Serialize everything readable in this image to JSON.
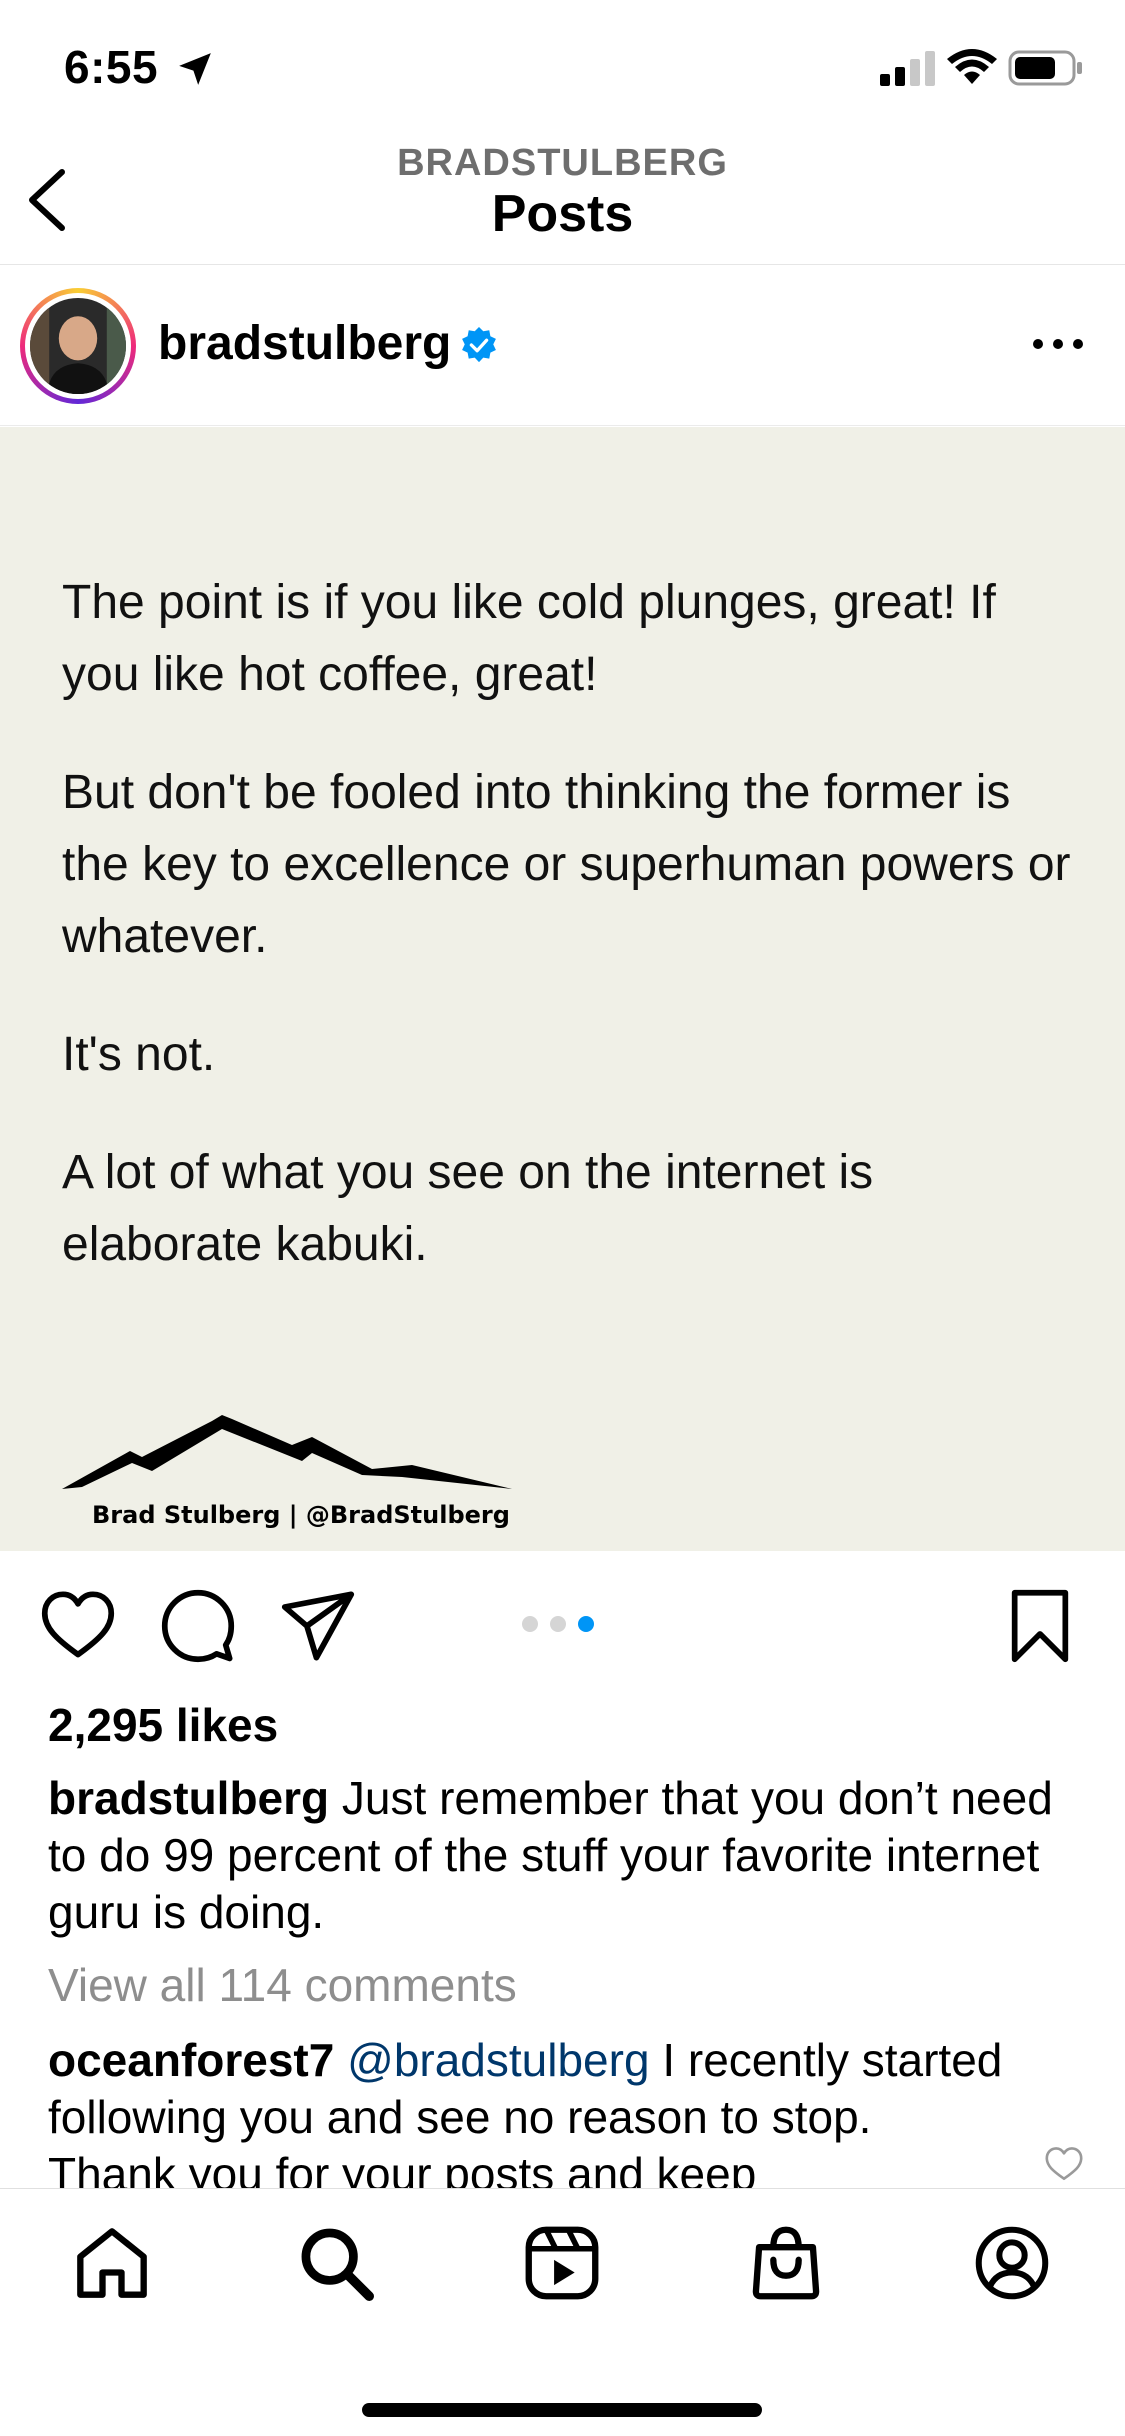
{
  "status_bar": {
    "time": "6:55",
    "icons": [
      "location-arrow-icon",
      "signal-icon",
      "wifi-icon",
      "battery-icon"
    ]
  },
  "header": {
    "subtitle": "BRADSTULBERG",
    "title": "Posts",
    "back_icon": "chevron-left-icon"
  },
  "post": {
    "username": "bradstulberg",
    "verified": true,
    "more_icon": "ellipsis-icon",
    "image_text": [
      "The point is if you like cold plunges, great! If you like hot coffee, great!",
      "But don't be fooled into thinking the former is the key to excellence or superhuman powers or whatever.",
      "It's not.",
      "A lot of what you see on the internet is elaborate kabuki."
    ],
    "watermark": "Brad Stulberg | @BradStulberg",
    "carousel": {
      "count": 3,
      "active": 3
    },
    "likes": "2,295 likes",
    "caption_user": "bradstulberg",
    "caption_text": " Just remember that you don’t need to do 99 percent of the stuff your favorite internet guru is doing.",
    "view_all_comments": "View all 114 comments",
    "comment": {
      "user": "oceanforest7",
      "mention": "@bradstulberg",
      "text": " I recently started following you and see no reason to stop. Thank you for your posts and keep"
    }
  },
  "actions": [
    "heart-icon",
    "comment-icon",
    "share-icon",
    "bookmark-icon"
  ],
  "tabbar": [
    "home-icon",
    "search-icon",
    "reels-icon",
    "shop-icon",
    "profile-icon"
  ],
  "colors": {
    "image_bg": "#f0f0e7",
    "verified": "#0095f6",
    "mention": "#00376b",
    "muted": "#8e8e8e"
  }
}
